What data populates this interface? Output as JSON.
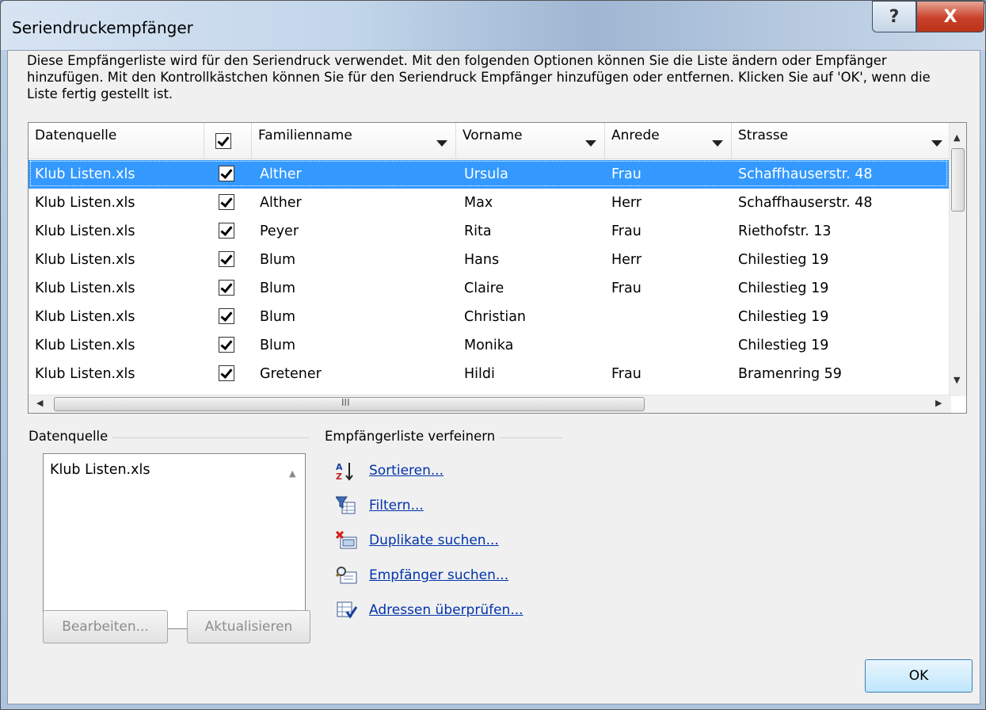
{
  "window": {
    "title": "Seriendruckempfänger",
    "help_glyph": "?",
    "close_glyph": "X"
  },
  "description": "Diese Empfängerliste wird für den Seriendruck verwendet. Mit den folgenden Optionen können Sie die Liste ändern oder Empfänger hinzufügen. Mit den Kontrollkästchen können Sie für den Seriendruck Empfänger hinzufügen oder entfernen. Klicken Sie auf 'OK', wenn die Liste fertig gestellt ist.",
  "list": {
    "columns": [
      "Datenquelle",
      "",
      "Familienname",
      "Vorname",
      "Anrede",
      "Strasse"
    ],
    "rows": [
      {
        "source": "Klub Listen.xls",
        "checked": true,
        "last": "Alther",
        "first": "Ursula",
        "salutation": "Frau",
        "street": "Schaffhauserstr. 48",
        "selected": true
      },
      {
        "source": "Klub Listen.xls",
        "checked": true,
        "last": "Alther",
        "first": "Max",
        "salutation": "Herr",
        "street": "Schaffhauserstr. 48"
      },
      {
        "source": "Klub Listen.xls",
        "checked": true,
        "last": "Peyer",
        "first": "Rita",
        "salutation": "Frau",
        "street": "Riethofstr. 13"
      },
      {
        "source": "Klub Listen.xls",
        "checked": true,
        "last": "Blum",
        "first": "Hans",
        "salutation": "Herr",
        "street": "Chilestieg 19"
      },
      {
        "source": "Klub Listen.xls",
        "checked": true,
        "last": "Blum",
        "first": "Claire",
        "salutation": "Frau",
        "street": "Chilestieg 19"
      },
      {
        "source": "Klub Listen.xls",
        "checked": true,
        "last": "Blum",
        "first": "Christian",
        "salutation": "",
        "street": "Chilestieg 19"
      },
      {
        "source": "Klub Listen.xls",
        "checked": true,
        "last": "Blum",
        "first": "Monika",
        "salutation": "",
        "street": "Chilestieg 19"
      },
      {
        "source": "Klub Listen.xls",
        "checked": true,
        "last": "Gretener",
        "first": "Hildi",
        "salutation": "Frau",
        "street": "Bramenring 59"
      }
    ],
    "hscroll_grip": "III"
  },
  "datasource": {
    "label": "Datenquelle",
    "items": [
      "Klub Listen.xls"
    ],
    "edit_button": "Bearbeiten...",
    "refresh_button": "Aktualisieren"
  },
  "refine": {
    "label": "Empfängerliste verfeinern",
    "links": [
      {
        "label": "Sortieren...",
        "icon": "sort-az-icon"
      },
      {
        "label": "Filtern...",
        "icon": "filter-icon"
      },
      {
        "label": "Duplikate suchen...",
        "icon": "duplicates-icon"
      },
      {
        "label": "Empfänger suchen...",
        "icon": "find-recipient-icon"
      },
      {
        "label": "Adressen überprüfen...",
        "icon": "validate-addresses-icon"
      }
    ]
  },
  "ok_button": "OK"
}
